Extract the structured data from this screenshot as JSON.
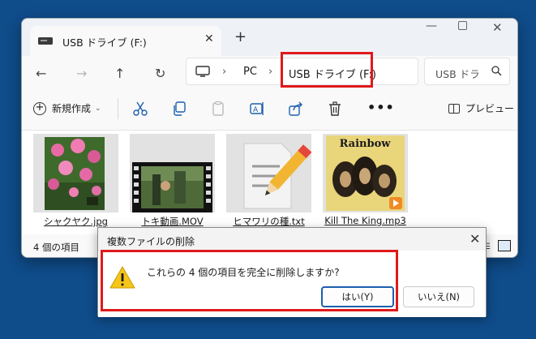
{
  "window": {
    "tab_title": "USB ドライブ (F:)",
    "new_tab": "+",
    "close": "✕"
  },
  "nav": {
    "address": {
      "separator": "›",
      "root": "PC",
      "current": "USB ドライブ (F:)"
    },
    "search_placeholder": "USB ドラ"
  },
  "toolbar": {
    "new_label": "新規作成",
    "more": "•••",
    "preview_label": "プレビュー"
  },
  "files": [
    {
      "name": "シャクヤク.jpg"
    },
    {
      "name": "トキ動画.MOV"
    },
    {
      "name": "ヒマワリの種.txt"
    },
    {
      "name": "Kill The King.mp3",
      "album_title": "Rainbow"
    }
  ],
  "status": {
    "item_count": "4 個の項目"
  },
  "dialog": {
    "title": "複数ファイルの削除",
    "message": "これらの 4 個の項目を完全に削除しますか?",
    "yes_label": "はい(Y)",
    "no_label": "いいえ(N)",
    "close": "✕"
  },
  "colors": {
    "desktop": "#0f4c8a",
    "highlight": "#e0191b",
    "default_button_border": "#1c5fae",
    "warning": "#f5c518"
  }
}
